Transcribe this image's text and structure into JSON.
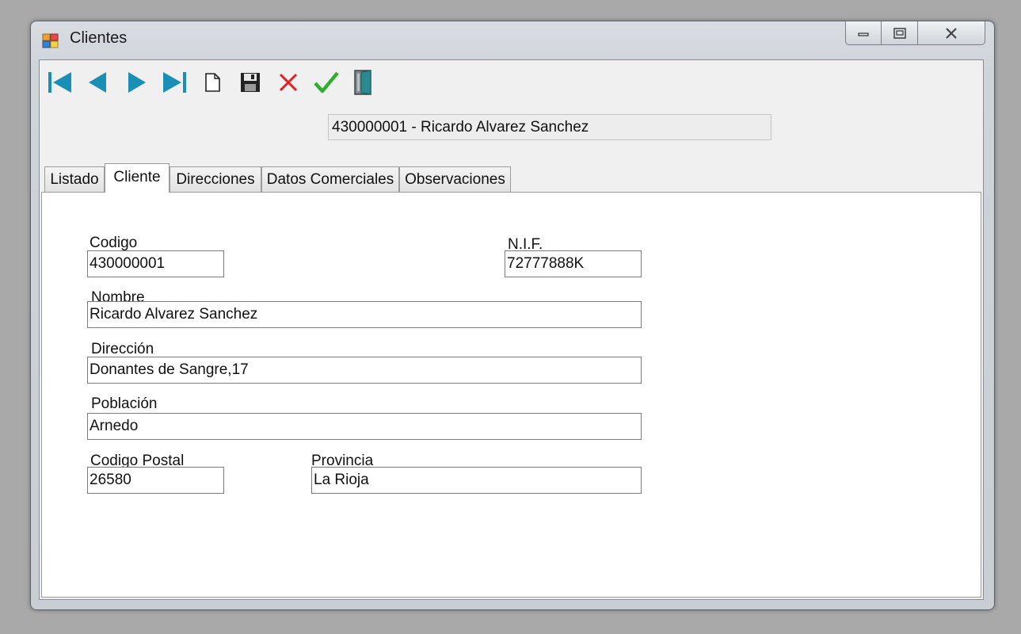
{
  "window": {
    "title": "Clientes",
    "app_icon": "windows-form-icon"
  },
  "toolbar": {
    "buttons": [
      {
        "name": "first-record",
        "icon": "first-icon"
      },
      {
        "name": "previous-record",
        "icon": "previous-icon"
      },
      {
        "name": "next-record",
        "icon": "next-icon"
      },
      {
        "name": "last-record",
        "icon": "last-icon"
      },
      {
        "name": "new-record",
        "icon": "new-document-icon"
      },
      {
        "name": "save-record",
        "icon": "floppy-disk-icon"
      },
      {
        "name": "delete-record",
        "icon": "red-x-icon"
      },
      {
        "name": "accept",
        "icon": "green-check-icon"
      },
      {
        "name": "exit",
        "icon": "door-exit-icon"
      }
    ]
  },
  "record_header": "430000001 - Ricardo Alvarez Sanchez",
  "tabs": [
    {
      "label": "Listado",
      "active": false
    },
    {
      "label": "Cliente",
      "active": true
    },
    {
      "label": "Direcciones",
      "active": false
    },
    {
      "label": "Datos Comerciales",
      "active": false
    },
    {
      "label": "Observaciones",
      "active": false
    }
  ],
  "form": {
    "codigo": {
      "label": "Codigo",
      "value": "430000001"
    },
    "nif": {
      "label": "N.I.F.",
      "value": "72777888K"
    },
    "nombre": {
      "label": "Nombre",
      "value": "Ricardo Alvarez Sanchez"
    },
    "direccion": {
      "label": "Dirección",
      "value": "Donantes de Sangre,17"
    },
    "poblacion": {
      "label": "Población",
      "value": "Arnedo"
    },
    "codigo_postal": {
      "label": "Codigo Postal",
      "value": "26580"
    },
    "provincia": {
      "label": "Provincia",
      "value": "La Rioja"
    }
  },
  "colors": {
    "nav_arrow": "#1a8fb5",
    "delete": "#e02020",
    "accept": "#2fae2f",
    "tab_border": "#9b9b9b"
  }
}
